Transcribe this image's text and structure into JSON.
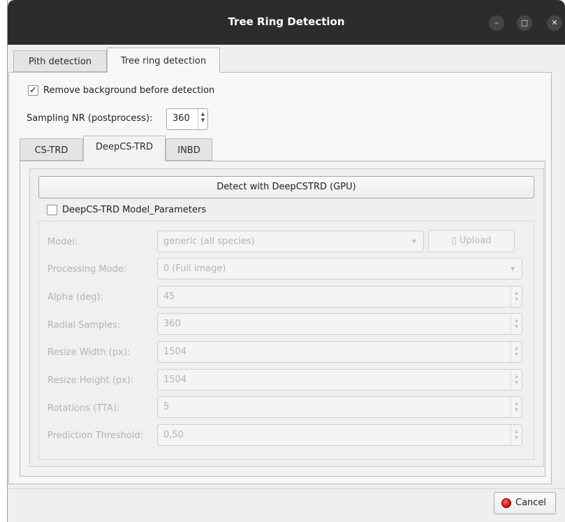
{
  "window": {
    "title": "Tree Ring Detection"
  },
  "tabs": [
    {
      "label": "Pith detection",
      "active": false
    },
    {
      "label": "Tree ring detection",
      "active": true
    }
  ],
  "remove_background": {
    "label": "Remove background before detection",
    "checked": true
  },
  "sampling": {
    "label": "Sampling NR (postprocess):",
    "value": "360"
  },
  "method_tabs": [
    {
      "label": "CS-TRD",
      "active": false
    },
    {
      "label": "DeepCS-TRD",
      "active": true
    },
    {
      "label": "INBD",
      "active": false
    }
  ],
  "detect_button": {
    "label": "Detect with DeepCSTRD (GPU)"
  },
  "model_params": {
    "checkbox_label": "DeepCS-TRD Model_Parameters",
    "checked": false,
    "rows": [
      {
        "label": "Model:",
        "value": "generic (all species)"
      },
      {
        "label": "Processing Mode:",
        "value": "0 (Full image)"
      },
      {
        "label": "Alpha (deg):",
        "value": "45"
      },
      {
        "label": "Radial Samples:",
        "value": "360"
      },
      {
        "label": "Resize Width (px):",
        "value": "1504"
      },
      {
        "label": "Resize Height (px):",
        "value": "1504"
      },
      {
        "label": "Rotations (TTA):",
        "value": "5"
      },
      {
        "label": "Prediction Threshold:",
        "value": "0,50"
      }
    ],
    "upload_label": "▯ Upload"
  },
  "cancel_button": {
    "label": "Cancel"
  },
  "colors": {
    "titlebar": "#2c2c2c",
    "cancel_icon": "#d00000"
  }
}
